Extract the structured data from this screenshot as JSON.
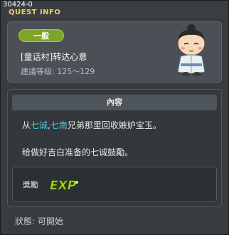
{
  "window": {
    "quest_id": "30424-0",
    "title": "QUEST INFO"
  },
  "header": {
    "category_badge": "一般",
    "quest_name": "[童话村]转达心意",
    "level_label": "建議等级: 125～129"
  },
  "content": {
    "section_title": "內容",
    "line1_prefix": "从",
    "line1_name1": "七诚",
    "line1_sep": ",",
    "line1_name2": "七南",
    "line1_suffix": "兄弟那里回收嫉妒宝玉。",
    "line2": "给做好吉白准备的七诚鼓勵。"
  },
  "reward": {
    "label": "獎勵",
    "icon": "exp-icon",
    "icon_text": "EXP"
  },
  "status": {
    "text": "狀態:  可開始"
  },
  "colors": {
    "title": "#f0d060",
    "badge": "#7ea52a",
    "highlight": "#44c7d8",
    "exp": "#a8e21c"
  }
}
